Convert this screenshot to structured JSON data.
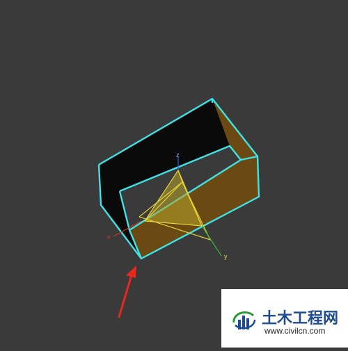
{
  "viewport": {
    "background": "#3a3a3a",
    "object_outline_color": "#3fe3e6",
    "gizmo_color": "#e6d23a",
    "gizmo_fill_color": "#b8a62a",
    "side_face_color": "#6e4a10",
    "arrow_color": "#e8281e"
  },
  "axes": {
    "x_label": "x",
    "y_label": "y",
    "z_label": "z",
    "x_color": "#d23a1e",
    "y_color": "#3ab43a",
    "z_color": "#3a5ad2"
  },
  "watermark": {
    "name": "土木工程网",
    "url": "www.civilcn.com",
    "name_color": "#1f4b8f",
    "logo_icon": "building-bars-logo"
  }
}
